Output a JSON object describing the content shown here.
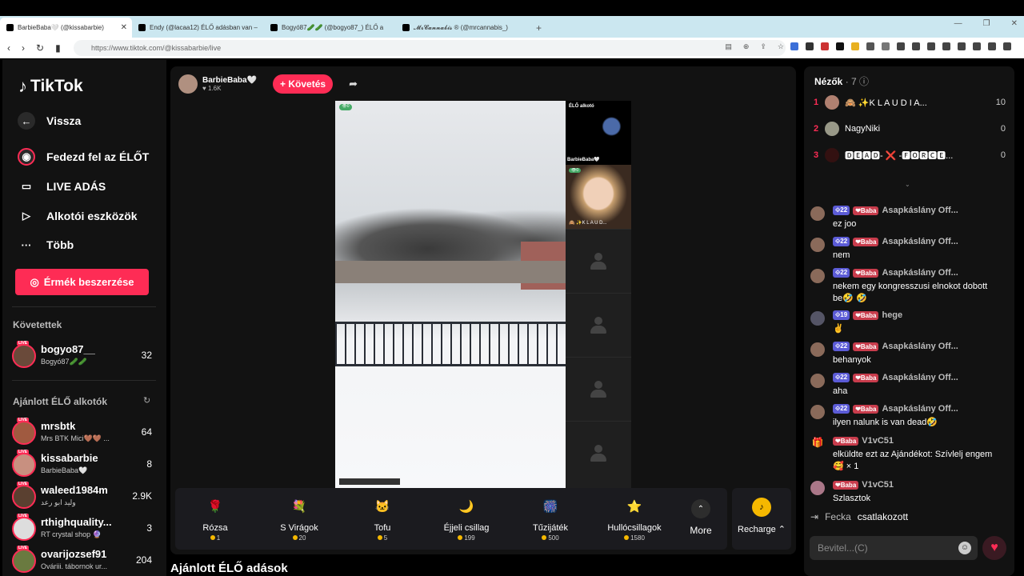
{
  "browser": {
    "tabs": [
      {
        "title": "BarbieBaba🤍 (@kissabarbie)",
        "active": true
      },
      {
        "title": "Endy (@lacaa12) ÉLŐ adásban van –",
        "active": false
      },
      {
        "title": "Bogyó87🥒🥒 (@bogyo87_) ÉLŐ a",
        "active": false
      },
      {
        "title": "𝓜𝓻𝓒𝓪𝓷𝓷𝓪𝓫𝓲𝓼 ® (@mrcannabis_)",
        "active": false
      }
    ],
    "url": "https://www.tiktok.com/@kissabarbie/live"
  },
  "sidebar": {
    "logo": "TikTok",
    "back": "Vissza",
    "nav": [
      "Fedezd fel az ÉLŐT",
      "LIVE ADÁS",
      "Alkotói eszközök",
      "Több"
    ],
    "earn_button": "Érmék beszerzése",
    "following_title": "Követettek",
    "following": [
      {
        "name": "bogyo87__",
        "sub": "Bogyó87🥒🥒",
        "count": "32"
      }
    ],
    "recommended_title": "Ajánlott ÉLŐ alkotók",
    "recommended": [
      {
        "name": "mrsbtk",
        "sub": "Mrs BTK Mici🤎🤎 ...",
        "count": "64"
      },
      {
        "name": "kissabarbie",
        "sub": "BarbieBaba🤍",
        "count": "8"
      },
      {
        "name": "waleed1984m",
        "sub": "وليد ابو رعد",
        "count": "2.9K"
      },
      {
        "name": "rthighquality...",
        "sub": "RT crystal shop 🔮",
        "count": "3"
      },
      {
        "name": "ovarijozsef91",
        "sub": "Ováriii. táborn​ok ur...",
        "count": "204"
      }
    ],
    "live_badge": "LIVE"
  },
  "stream": {
    "host_name": "BarbieBaba🤍",
    "host_likes": "♥ 1.6K",
    "follow_button": "+ Követés",
    "video_badge": "👁0",
    "guest_title": "ÉLŐ alkotó",
    "guest1_name": "BarbieBaba🤍",
    "guest2_badge": "👁0",
    "guest2_name": "🙈 ✨K L A U D..."
  },
  "gifts": [
    {
      "name": "Rózsa",
      "price": "1",
      "icon": "🌹"
    },
    {
      "name": "S Virágok",
      "price": "20",
      "icon": "💐"
    },
    {
      "name": "Tofu",
      "price": "5",
      "icon": "🐱"
    },
    {
      "name": "Éjjeli csillag",
      "price": "199",
      "icon": "🌙"
    },
    {
      "name": "Tűzijáték",
      "price": "500",
      "icon": "🎆"
    },
    {
      "name": "Hullócsillagok",
      "price": "1580",
      "icon": "⭐"
    }
  ],
  "more_label": "More",
  "recharge_label": "Recharge ⌃",
  "below_title": "Ajánlott ÉLŐ adások",
  "viewers": {
    "title": "Nézők",
    "count": "· 7",
    "list": [
      {
        "rank": "1",
        "name": "🙈 ✨K L A U D I A...",
        "score": "10"
      },
      {
        "rank": "2",
        "name": "NagyNiki",
        "score": "0"
      },
      {
        "rank": "3",
        "name": "🅳🅴🅰🅳- ❌ -🅵🅾🆁🅲🅴...",
        "score": "0"
      }
    ]
  },
  "chat": [
    {
      "lvl": "⟐22",
      "fan": "❤Baba",
      "name": "Asapkáslány Off...",
      "text": "ez joo"
    },
    {
      "lvl": "⟐22",
      "fan": "❤Baba",
      "name": "Asapkáslány Off...",
      "text": "nem"
    },
    {
      "lvl": "⟐22",
      "fan": "❤Baba",
      "name": "Asapkáslány Off...",
      "text": "nekem egy kongresszusi elnokot dobott be🤣 🤣"
    },
    {
      "lvl": "⟐19",
      "fan": "❤Baba",
      "name": "hege",
      "text": "✌"
    },
    {
      "lvl": "⟐22",
      "fan": "❤Baba",
      "name": "Asapkáslány Off...",
      "text": "behanyok"
    },
    {
      "lvl": "⟐22",
      "fan": "❤Baba",
      "name": "Asapkáslány Off...",
      "text": "aha"
    },
    {
      "lvl": "⟐22",
      "fan": "❤Baba",
      "name": "Asapkáslány Off...",
      "text": "ilyen nalunk is van dead🤣"
    },
    {
      "lvl": "",
      "fan": "❤Baba",
      "name": "V1vC51",
      "text": "elküldte ezt az Ajándékot: Szívlelj engem 🥰 × 1"
    },
    {
      "lvl": "",
      "fan": "❤Baba",
      "name": "V1vC51",
      "text": "Szlasztok"
    }
  ],
  "join": {
    "user": "Fecka",
    "action": "csatlakozott"
  },
  "input_placeholder": "Bevitel...(C)"
}
